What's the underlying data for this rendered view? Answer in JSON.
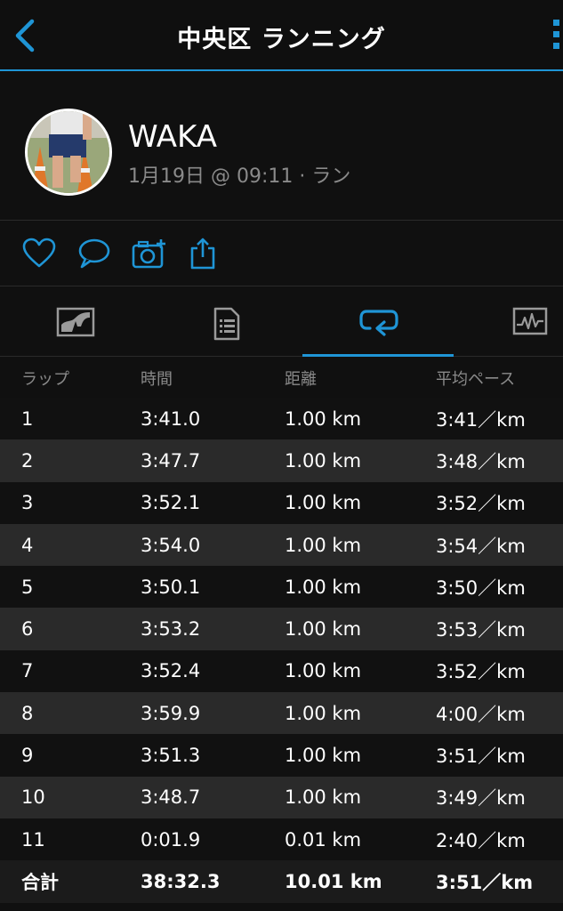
{
  "header": {
    "title": "中央区 ランニング"
  },
  "profile": {
    "name": "WAKA",
    "meta": "1月19日 @ 09:11 · ラン"
  },
  "actions": [
    "like-icon",
    "comment-icon",
    "add-photo-icon",
    "share-icon"
  ],
  "tabs": [
    {
      "icon": "map-chart-icon"
    },
    {
      "icon": "details-document-icon"
    },
    {
      "icon": "laps-loop-icon",
      "active": true
    },
    {
      "icon": "stats-graph-icon"
    }
  ],
  "laps": {
    "headers": [
      "ラップ",
      "時間",
      "距離",
      "平均ペース"
    ],
    "rows": [
      {
        "lap": "1",
        "time": "3:41.0",
        "distance": "1.00 km",
        "pace": "3:41／km"
      },
      {
        "lap": "2",
        "time": "3:47.7",
        "distance": "1.00 km",
        "pace": "3:48／km"
      },
      {
        "lap": "3",
        "time": "3:52.1",
        "distance": "1.00 km",
        "pace": "3:52／km"
      },
      {
        "lap": "4",
        "time": "3:54.0",
        "distance": "1.00 km",
        "pace": "3:54／km"
      },
      {
        "lap": "5",
        "time": "3:50.1",
        "distance": "1.00 km",
        "pace": "3:50／km"
      },
      {
        "lap": "6",
        "time": "3:53.2",
        "distance": "1.00 km",
        "pace": "3:53／km"
      },
      {
        "lap": "7",
        "time": "3:52.4",
        "distance": "1.00 km",
        "pace": "3:52／km"
      },
      {
        "lap": "8",
        "time": "3:59.9",
        "distance": "1.00 km",
        "pace": "4:00／km"
      },
      {
        "lap": "9",
        "time": "3:51.3",
        "distance": "1.00 km",
        "pace": "3:51／km"
      },
      {
        "lap": "10",
        "time": "3:48.7",
        "distance": "1.00 km",
        "pace": "3:49／km"
      },
      {
        "lap": "11",
        "time": "0:01.9",
        "distance": "0.01 km",
        "pace": "2:40／km"
      }
    ],
    "total": {
      "label": "合計",
      "time": "38:32.3",
      "distance": "10.01 km",
      "pace": "3:51／km"
    }
  },
  "colors": {
    "accent": "#1f95d6",
    "background": "#101010",
    "row_alt": "#2a2a2a",
    "muted_text": "#8a8a8a"
  }
}
